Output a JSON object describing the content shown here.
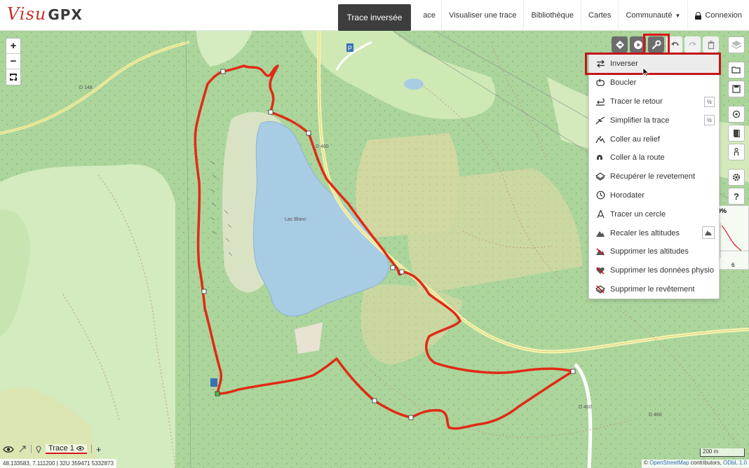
{
  "header": {
    "logo_part1": "Visu",
    "logo_part2": "GPX",
    "tooltip": "Trace inversée",
    "nav": {
      "partial_item": "ace",
      "visualiser": "Visualiser une trace",
      "bibliotheque": "Bibliothèque",
      "cartes": "Cartes",
      "communaute": "Communauté",
      "connexion": "Connexion"
    }
  },
  "map": {
    "labels": {
      "lake": "Lac Blanc",
      "d148": "D 148",
      "d460_a": "D 460",
      "d460_b": "D 460",
      "d460_c": "D 460"
    }
  },
  "zoom": {
    "in": "+",
    "out": "−"
  },
  "toolbar_icons": [
    "direction-icon",
    "play-icon",
    "wrench-icon",
    "undo-icon",
    "redo-icon",
    "trash-icon"
  ],
  "menu": {
    "items": [
      {
        "label": "Inverser",
        "icon": "swap-icon"
      },
      {
        "label": "Boucler",
        "icon": "loop-icon"
      },
      {
        "label": "Tracer le retour",
        "icon": "return-icon",
        "badge": "½"
      },
      {
        "label": "Simplifier la trace",
        "icon": "simplify-icon",
        "badge": "½"
      },
      {
        "label": "Coller au relief",
        "icon": "relief-icon"
      },
      {
        "label": "Coller à la route",
        "icon": "road-magnet-icon"
      },
      {
        "label": "Récupérer le revetement",
        "icon": "surface-icon"
      },
      {
        "label": "Horodater",
        "icon": "clock-icon"
      },
      {
        "label": "Tracer un cercle",
        "icon": "circle-compass-icon"
      },
      {
        "label": "Recaler les altitudes",
        "icon": "altitude-icon"
      },
      {
        "label": "Supprimer les altitudes",
        "icon": "delete-altitude-icon"
      },
      {
        "label": "Supprimer les données physio",
        "icon": "delete-heart-icon"
      },
      {
        "label": "Supprimer le revêtement",
        "icon": "delete-surface-icon"
      }
    ]
  },
  "elevation": {
    "percent": "0%",
    "value": "6"
  },
  "bottom": {
    "trace_name": "Trace 1",
    "add": "+",
    "coords": "48.133583, 7.111200 | 32U 359471 5332873",
    "scale": "200 m",
    "attribution_prefix": "© ",
    "attribution_osm": "OpenStreetMap",
    "attribution_mid": " contributors, ",
    "attribution_odbl": "ODbL 1.0"
  },
  "colors": {
    "track": "#e12a16",
    "forest": "#a9d39a",
    "meadow": "#cde8b6",
    "lake": "#a9cce5",
    "highlight_box": "#d9141b"
  }
}
